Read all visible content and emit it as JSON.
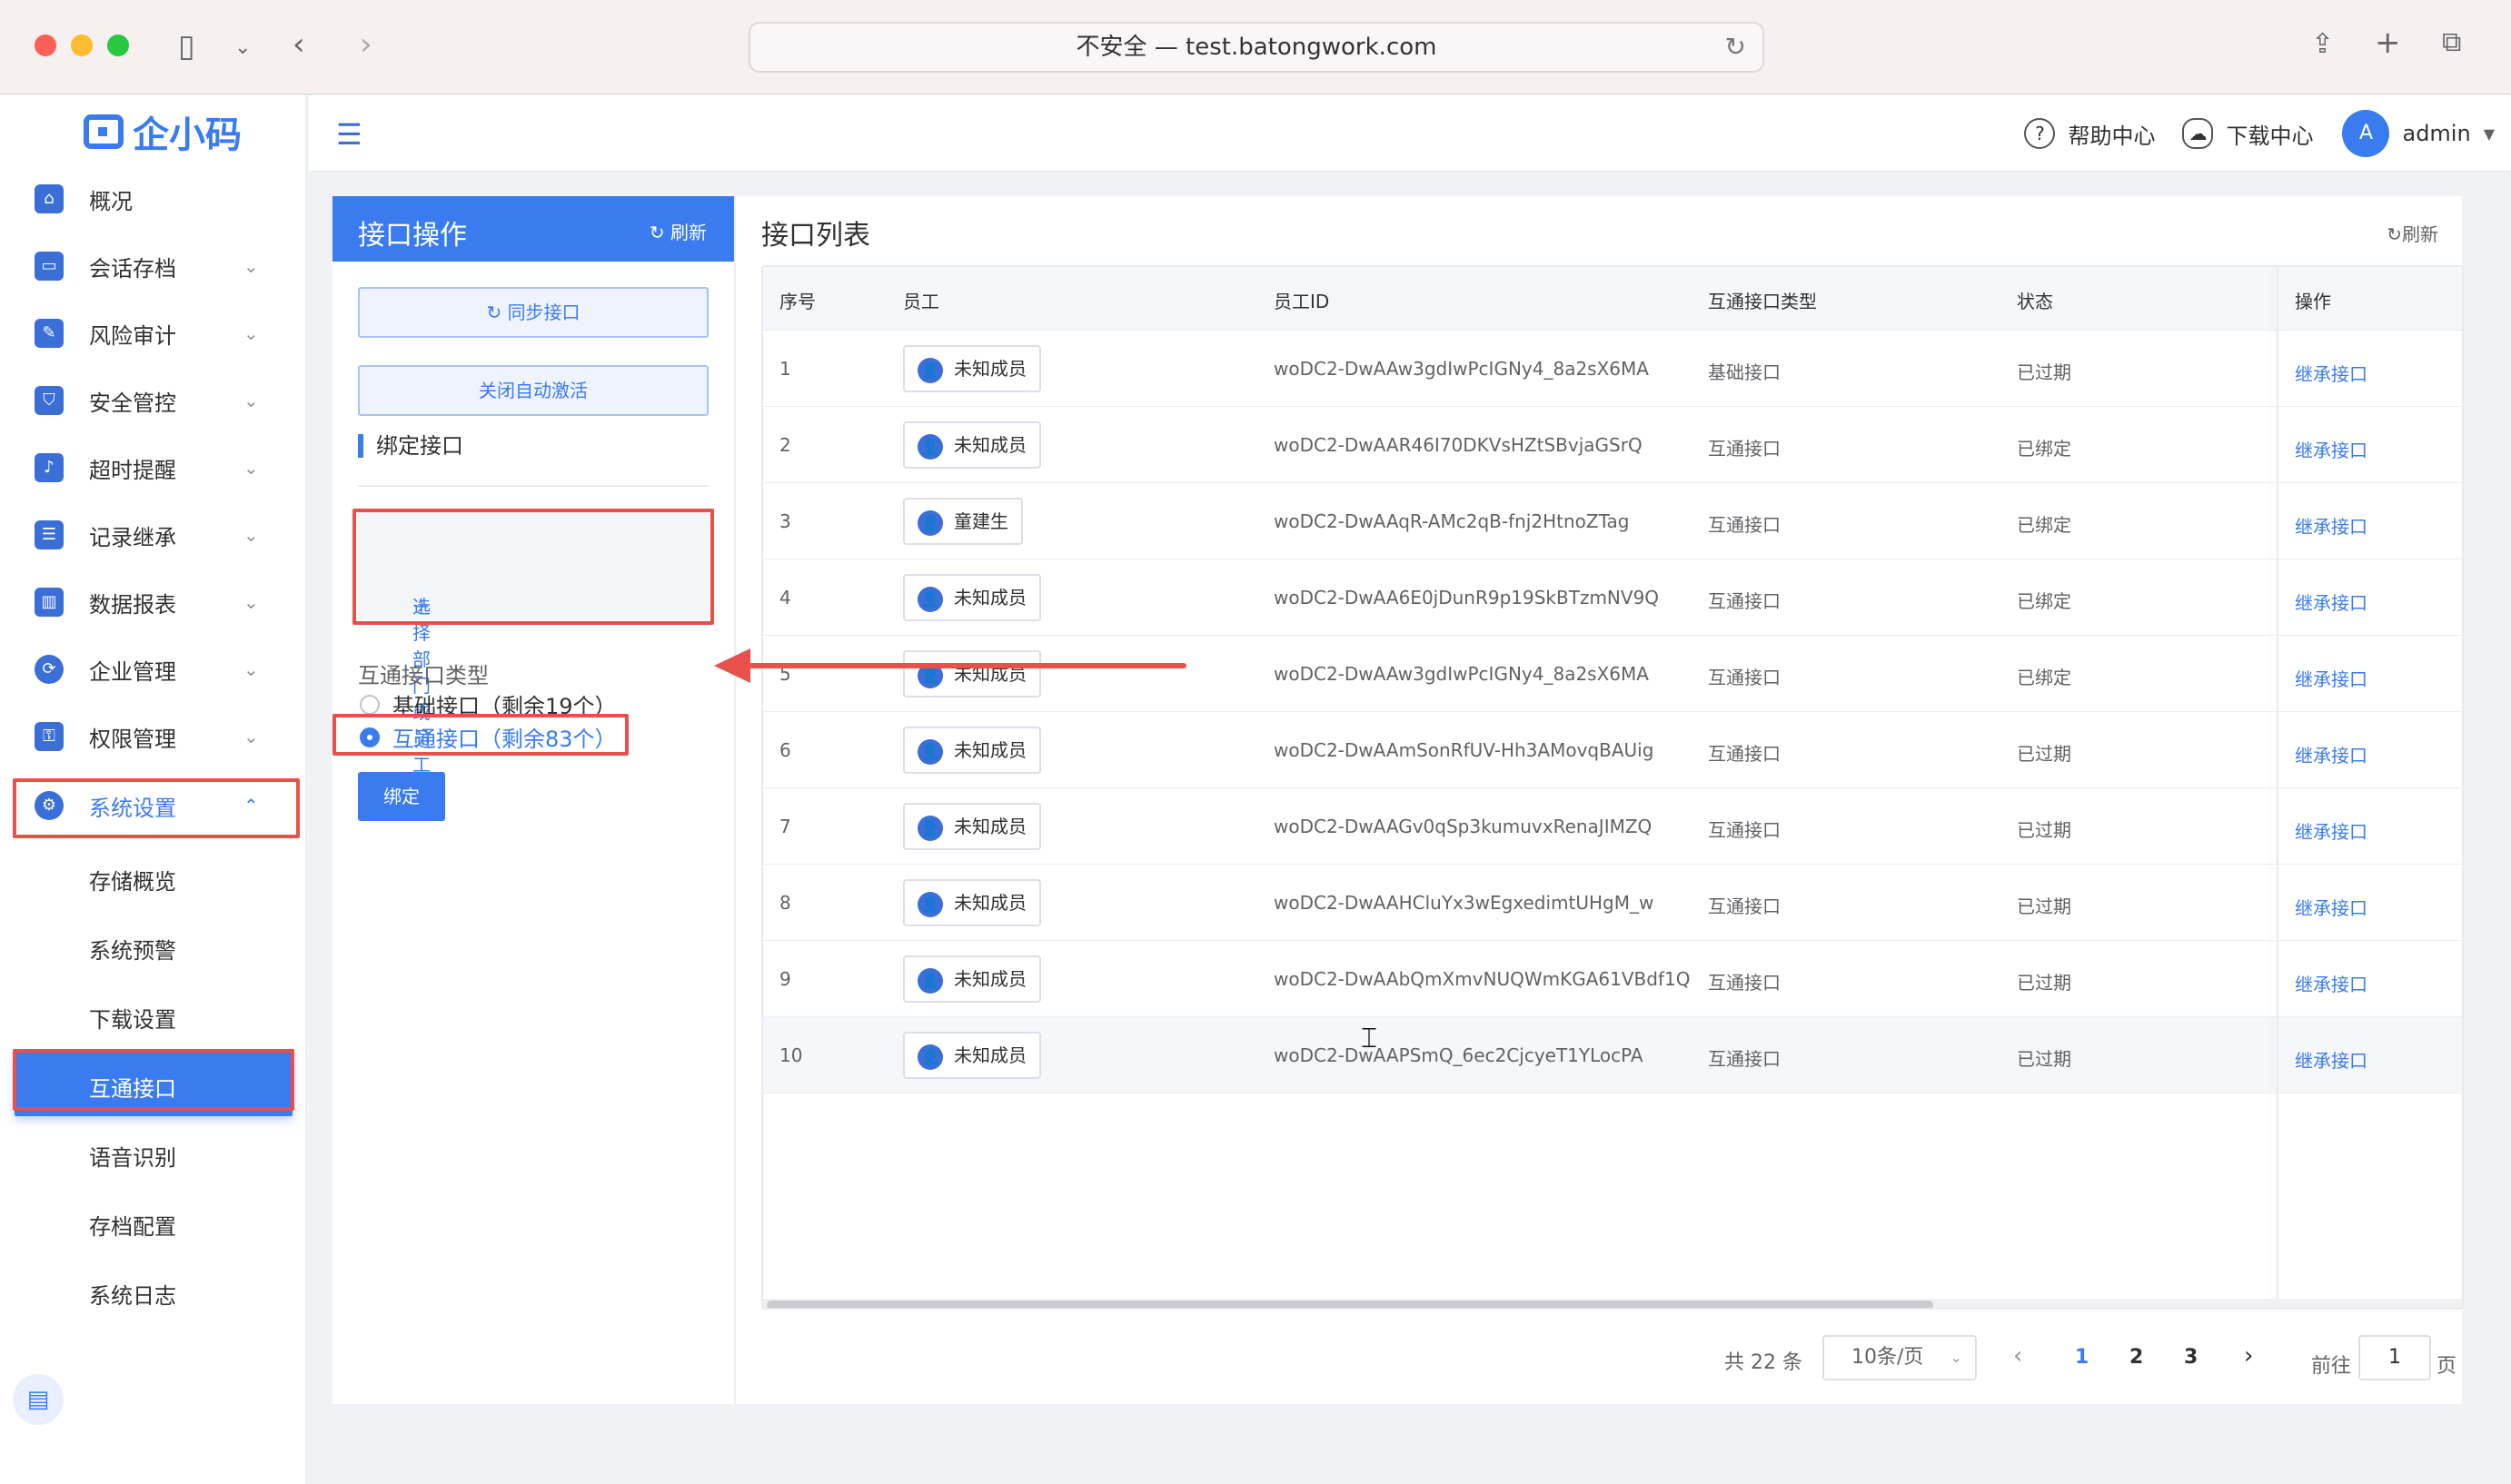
{
  "browser": {
    "url_text": "不安全 — test.batongwork.com"
  },
  "logo": {
    "text": "企小码"
  },
  "sidebar": {
    "items": [
      {
        "label": "概况",
        "icon": "home-icon",
        "has_chevron": false
      },
      {
        "label": "会话存档",
        "icon": "folder-icon",
        "has_chevron": true
      },
      {
        "label": "风险审计",
        "icon": "audit-icon",
        "has_chevron": true
      },
      {
        "label": "安全管控",
        "icon": "shield-icon",
        "has_chevron": true
      },
      {
        "label": "超时提醒",
        "icon": "bell-icon",
        "has_chevron": true
      },
      {
        "label": "记录继承",
        "icon": "record-icon",
        "has_chevron": true
      },
      {
        "label": "数据报表",
        "icon": "chart-icon",
        "has_chevron": true
      },
      {
        "label": "企业管理",
        "icon": "sync-icon",
        "has_chevron": true
      },
      {
        "label": "权限管理",
        "icon": "lock-icon",
        "has_chevron": true
      },
      {
        "label": "系统设置",
        "icon": "gear-icon",
        "has_chevron": true,
        "expanded": true
      }
    ],
    "sub_items": [
      "存储概览",
      "系统预警",
      "下载设置",
      "互通接口",
      "语音识别",
      "存档配置",
      "系统日志"
    ],
    "selected_sub": "互通接口"
  },
  "header": {
    "help": "帮助中心",
    "download": "下载中心",
    "avatar_letter": "A",
    "user": "admin"
  },
  "left_panel": {
    "title": "接口操作",
    "refresh": "刷新",
    "sync_button": "同步接口",
    "close_auto_button": "关闭自动激活",
    "bind_title": "绑定接口",
    "select_placeholder": "选择部门或员工",
    "type_label": "互通接口类型",
    "options": [
      {
        "label": "基础接口（剩余19个）",
        "checked": false
      },
      {
        "label": "互通接口（剩余83个）",
        "checked": true
      }
    ],
    "bind_button": "绑定"
  },
  "main": {
    "title": "接口列表",
    "refresh": "刷新",
    "columns": [
      "序号",
      "员工",
      "员工ID",
      "互通接口类型",
      "状态",
      "操作"
    ],
    "rows": [
      {
        "no": "1",
        "employee": "未知成员",
        "id": "woDC2-DwAAw3gdIwPcIGNy4_8a2sX6MA",
        "type": "基础接口",
        "status": "已过期",
        "op": "继承接口"
      },
      {
        "no": "2",
        "employee": "未知成员",
        "id": "woDC2-DwAAR46I70DKVsHZtSBvjaGSrQ",
        "type": "互通接口",
        "status": "已绑定",
        "op": "继承接口"
      },
      {
        "no": "3",
        "employee": "童建生",
        "id": "woDC2-DwAAqR-AMc2qB-fnj2HtnoZTag",
        "type": "互通接口",
        "status": "已绑定",
        "op": "继承接口"
      },
      {
        "no": "4",
        "employee": "未知成员",
        "id": "woDC2-DwAA6E0jDunR9p19SkBTzmNV9Q",
        "type": "互通接口",
        "status": "已绑定",
        "op": "继承接口"
      },
      {
        "no": "5",
        "employee": "未知成员",
        "id": "woDC2-DwAAw3gdIwPcIGNy4_8a2sX6MA",
        "type": "互通接口",
        "status": "已绑定",
        "op": "继承接口"
      },
      {
        "no": "6",
        "employee": "未知成员",
        "id": "woDC2-DwAAmSonRfUV-Hh3AMovqBAUig",
        "type": "互通接口",
        "status": "已过期",
        "op": "继承接口"
      },
      {
        "no": "7",
        "employee": "未知成员",
        "id": "woDC2-DwAAGv0qSp3kumuvxRenaJIMZQ",
        "type": "互通接口",
        "status": "已过期",
        "op": "继承接口"
      },
      {
        "no": "8",
        "employee": "未知成员",
        "id": "woDC2-DwAAHCluYx3wEgxedimtUHgM_w",
        "type": "互通接口",
        "status": "已过期",
        "op": "继承接口"
      },
      {
        "no": "9",
        "employee": "未知成员",
        "id": "woDC2-DwAAbQmXmvNUQWmKGA61VBdf1Q",
        "type": "互通接口",
        "status": "已过期",
        "op": "继承接口"
      },
      {
        "no": "10",
        "employee": "未知成员",
        "id": "woDC2-DwAAPSmQ_6ec2CjcyeT1YLocPA",
        "type": "互通接口",
        "status": "已过期",
        "op": "继承接口"
      }
    ],
    "pagination": {
      "total": "共 22 条",
      "page_size": "10条/页",
      "pages": [
        "1",
        "2",
        "3"
      ],
      "current": "1",
      "goto_label": "前往",
      "goto_value": "1",
      "goto_suffix": "页"
    }
  },
  "colors": {
    "accent": "#3a7bf0",
    "highlight": "#e8504a"
  }
}
